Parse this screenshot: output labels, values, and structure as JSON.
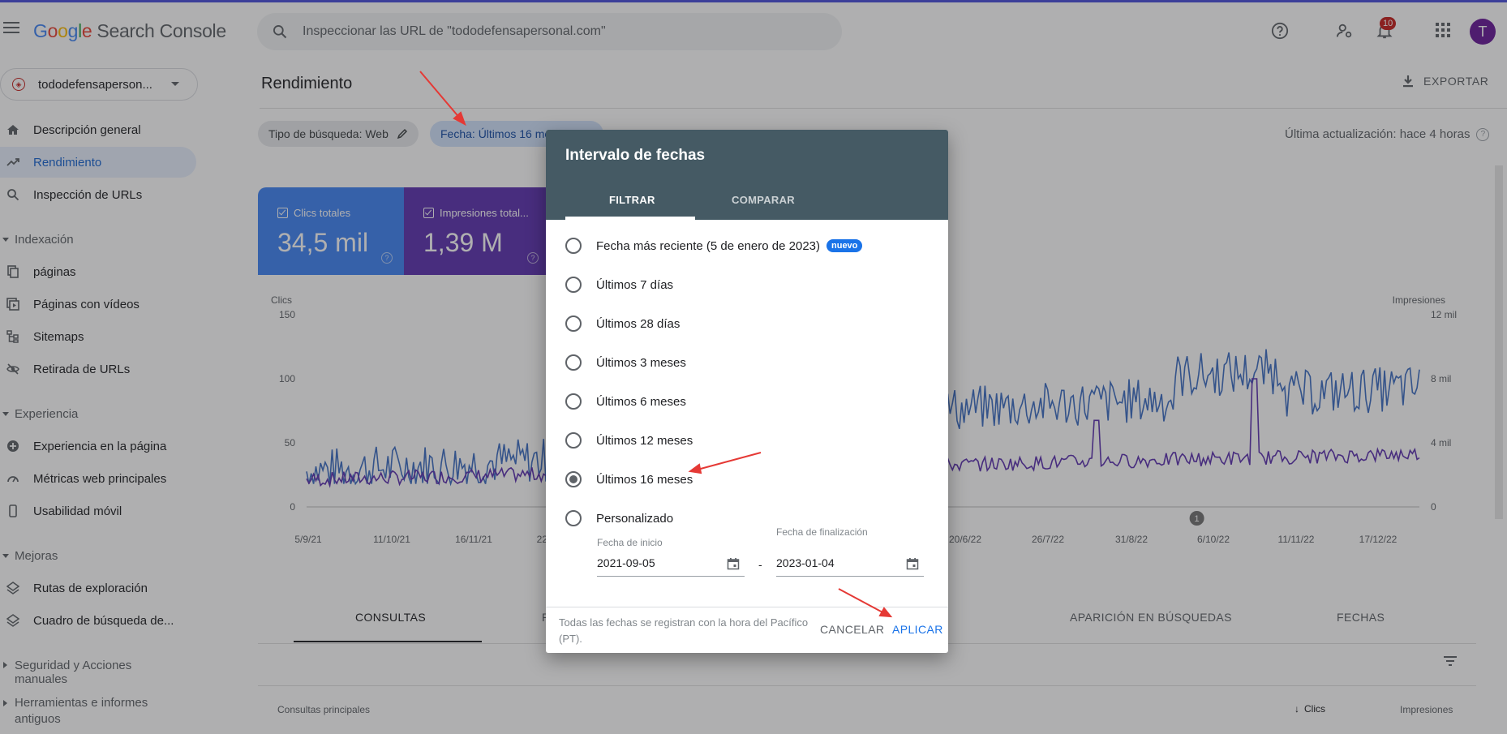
{
  "app": {
    "logo_letters": [
      "G",
      "o",
      "o",
      "g",
      "l",
      "e"
    ],
    "product": "Search Console",
    "search_placeholder": "Inspeccionar las URL de \"tododefensapersonal.com\"",
    "notifications_count": "10",
    "avatar_letter": "T"
  },
  "sidebar": {
    "property": "tododefensaperson...",
    "items": [
      {
        "label": "Descripción general",
        "icon": "home-icon"
      },
      {
        "label": "Rendimiento",
        "icon": "trending-up-icon",
        "active": true
      },
      {
        "label": "Inspección de URLs",
        "icon": "search-icon"
      }
    ],
    "sections": [
      {
        "label": "Indexación",
        "items": [
          {
            "label": "páginas",
            "icon": "pages-icon"
          },
          {
            "label": "Páginas con vídeos",
            "icon": "video-pages-icon"
          },
          {
            "label": "Sitemaps",
            "icon": "sitemap-icon"
          },
          {
            "label": "Retirada de URLs",
            "icon": "eye-off-icon"
          }
        ]
      },
      {
        "label": "Experiencia",
        "items": [
          {
            "label": "Experiencia en la página",
            "icon": "plus-circle-icon"
          },
          {
            "label": "Métricas web principales",
            "icon": "gauge-icon"
          },
          {
            "label": "Usabilidad móvil",
            "icon": "phone-icon"
          }
        ]
      },
      {
        "label": "Mejoras",
        "items": [
          {
            "label": "Rutas de exploración",
            "icon": "layers-icon"
          },
          {
            "label": "Cuadro de búsqueda de...",
            "icon": "layers-icon"
          }
        ]
      },
      {
        "label": "Seguridad y Acciones manuales"
      },
      {
        "label": "Herramientas e informes antiguos"
      }
    ]
  },
  "main": {
    "title": "Rendimiento",
    "export_label": "EXPORTAR",
    "chips": {
      "search_type": "Tipo de búsqueda: Web",
      "date": "Fecha: Últimos 16 meses"
    },
    "last_update": "Última actualización: hace 4 horas",
    "metrics": [
      {
        "label": "Clics totales",
        "value": "34,5 mil",
        "color": "#4285f4"
      },
      {
        "label": "Impresiones total...",
        "value": "1,39 M",
        "color": "#5e35b1"
      }
    ],
    "tabs": [
      "CONSULTAS",
      "P",
      "APARICIÓN EN BÚSQUEDAS",
      "FECHAS"
    ],
    "table_headers": {
      "left": "Consultas principales",
      "clicks": "Clics",
      "impressions": "Impresiones"
    }
  },
  "chart_data": {
    "type": "line",
    "x_tick_labels": [
      "5/9/21",
      "11/10/21",
      "16/11/21",
      "22/",
      "20/6/22",
      "26/7/22",
      "31/8/22",
      "6/10/22",
      "11/11/22",
      "17/12/22"
    ],
    "left_axis": {
      "label": "Clics",
      "ticks": [
        "0",
        "50",
        "100",
        "150"
      ],
      "ylim": [
        0,
        150
      ]
    },
    "right_axis": {
      "label": "Impresiones",
      "ticks": [
        "0",
        "4 mil",
        "8 mil",
        "12 mil"
      ],
      "ylim": [
        0,
        12000
      ]
    },
    "annotation": "1",
    "series": [
      {
        "name": "Clics totales",
        "color": "#3f6fc4",
        "axis": "left",
        "approx_range": [
          20,
          130
        ]
      },
      {
        "name": "Impresiones total...",
        "color": "#5e35b1",
        "axis": "right",
        "approx_range": [
          1500,
          8000
        ]
      }
    ]
  },
  "dialog": {
    "title": "Intervalo de fechas",
    "tabs": [
      "FILTRAR",
      "COMPARAR"
    ],
    "options": [
      {
        "label": "Fecha más reciente (5 de enero de 2023)",
        "badge": "nuevo"
      },
      {
        "label": "Últimos 7 días"
      },
      {
        "label": "Últimos 28 días"
      },
      {
        "label": "Últimos 3 meses"
      },
      {
        "label": "Últimos 6 meses"
      },
      {
        "label": "Últimos 12 meses"
      },
      {
        "label": "Últimos 16 meses",
        "checked": true
      },
      {
        "label": "Personalizado"
      }
    ],
    "start_label": "Fecha de inicio",
    "start_value": "2021-09-05",
    "end_label": "Fecha de finalización",
    "end_value": "2023-01-04",
    "separator": "-",
    "timezone_note": "Todas las fechas se registran con la hora del Pacífico (PT).",
    "cancel": "CANCELAR",
    "apply": "APLICAR"
  }
}
